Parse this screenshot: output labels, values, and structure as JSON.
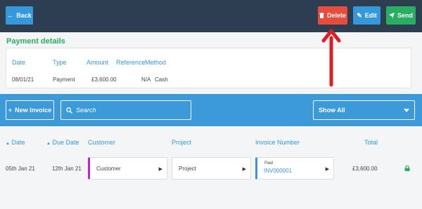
{
  "header": {
    "back_label": "Back",
    "delete_label": "Delete",
    "edit_label": "Edit",
    "send_label": "Send"
  },
  "payment": {
    "title": "Payment details",
    "columns": [
      "Date",
      "Type",
      "Amount",
      "Reference",
      "Method"
    ],
    "row": {
      "date": "08/01/21",
      "type": "Payment",
      "amount": "£3,600.00",
      "reference": "N/A",
      "method": "Cash"
    }
  },
  "toolbar": {
    "new_invoice_label": "New Invoice",
    "search_placeholder": "Search",
    "filter_value": "Show All"
  },
  "table": {
    "headers": {
      "date": "Date",
      "due_date": "Due Date",
      "customer": "Customer",
      "project": "Project",
      "invoice_number": "Invoice Number",
      "total": "Total"
    },
    "row": {
      "date": "05th Jan 21",
      "due_date": "12th Jan 21",
      "customer": "Customer",
      "project": "Project",
      "invoice_status": "Paid",
      "invoice_number": "INV000001",
      "total": "£3,600.00"
    }
  },
  "colors": {
    "header_bg": "#2c3e50",
    "accent_blue": "#3498db",
    "delete_red": "#e74c3c",
    "send_green": "#27ae60",
    "customer_marker": "#c51fd1",
    "lock_green": "#27ae60"
  },
  "icons": [
    "arrow-left-icon",
    "trash-icon",
    "pencil-icon",
    "paper-plane-icon",
    "plus-icon",
    "search-icon",
    "chevron-down-icon",
    "sort-up-icon",
    "lock-icon",
    "caret-right-icon"
  ]
}
